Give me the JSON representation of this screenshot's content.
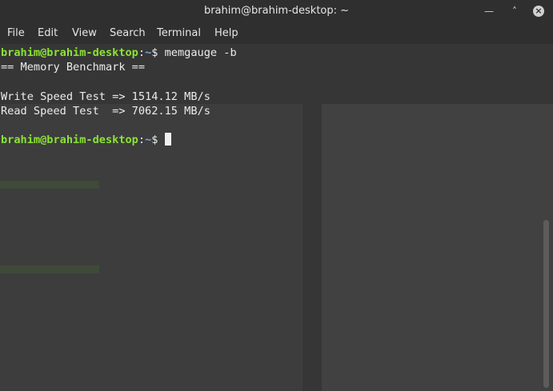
{
  "window": {
    "title": "brahim@brahim-desktop: ~",
    "minimize_icon": "minimize-icon",
    "maximize_icon": "maximize-icon",
    "close_icon": "close-icon"
  },
  "menu": {
    "file": "File",
    "edit": "Edit",
    "view": "View",
    "search": "Search",
    "terminal": "Terminal",
    "help": "Help"
  },
  "terminal": {
    "prompt_user": "brahim@brahim-desktop",
    "prompt_sep": ":",
    "prompt_path": "~",
    "prompt_symbol": "$ ",
    "command": "memgauge -b",
    "output_header": "== Memory Benchmark ==",
    "blank": "",
    "write_line": "Write Speed Test => 1514.12 MB/s",
    "read_line": "Read Speed Test  => 7062.15 MB/s"
  },
  "colors": {
    "prompt_user": "#8ae234",
    "prompt_path": "#7aa6da",
    "background": "#363636",
    "titlebar": "#2f2f2f"
  }
}
